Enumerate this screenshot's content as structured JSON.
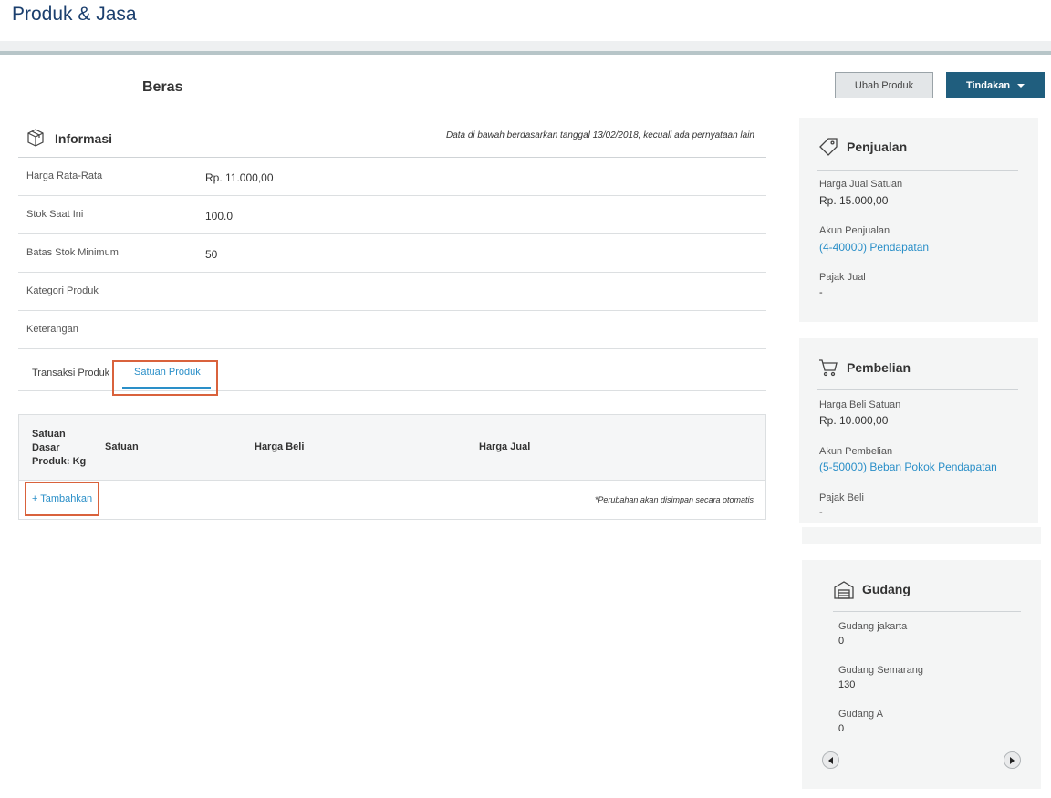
{
  "header": {
    "title": "Produk & Jasa"
  },
  "product": {
    "name": "Beras"
  },
  "actions": {
    "edit_label": "Ubah Produk",
    "actions_label": "Tindakan"
  },
  "info": {
    "title": "Informasi",
    "note": "Data di bawah berdasarkan tanggal 13/02/2018, kecuali ada pernyataan lain",
    "rows": [
      {
        "label": "Harga Rata-Rata",
        "value": "Rp. 11.000,00"
      },
      {
        "label": "Stok Saat Ini",
        "value": "100.0"
      },
      {
        "label": "Batas Stok Minimum",
        "value": "50"
      },
      {
        "label": "Kategori Produk",
        "value": ""
      },
      {
        "label": "Keterangan",
        "value": ""
      }
    ]
  },
  "tabs": [
    {
      "label": "Transaksi Produk",
      "active": false
    },
    {
      "label": "Satuan Produk",
      "active": true
    }
  ],
  "unit_table": {
    "headers": {
      "base_unit": "Satuan Dasar Produk: Kg",
      "unit": "Satuan",
      "buy_price": "Harga Beli",
      "sell_price": "Harga Jual"
    },
    "add_label": "+ Tambahkan",
    "autosave_note": "*Perubahan akan disimpan secara otomatis"
  },
  "sales": {
    "title": "Penjualan",
    "unit_price_label": "Harga Jual Satuan",
    "unit_price": "Rp. 15.000,00",
    "account_label": "Akun Penjualan",
    "account": "(4-40000) Pendapatan",
    "tax_label": "Pajak Jual",
    "tax": "-"
  },
  "purchase": {
    "title": "Pembelian",
    "unit_price_label": "Harga Beli Satuan",
    "unit_price": "Rp. 10.000,00",
    "account_label": "Akun Pembelian",
    "account": "(5-50000) Beban Pokok Pendapatan",
    "tax_label": "Pajak Beli",
    "tax": "-"
  },
  "warehouse": {
    "title": "Gudang",
    "items": [
      {
        "name": "Gudang jakarta",
        "qty": "0"
      },
      {
        "name": "Gudang Semarang",
        "qty": "130"
      },
      {
        "name": "Gudang A",
        "qty": "0"
      }
    ]
  },
  "colors": {
    "accent": "#2a8fc8",
    "primary_button": "#205e7e",
    "title": "#1b3f6e",
    "highlight": "#d9623c"
  },
  "icons": [
    "box-icon",
    "tag-icon",
    "cart-icon",
    "warehouse-icon",
    "caret-down-icon",
    "scroll-left-icon",
    "scroll-right-icon"
  ]
}
